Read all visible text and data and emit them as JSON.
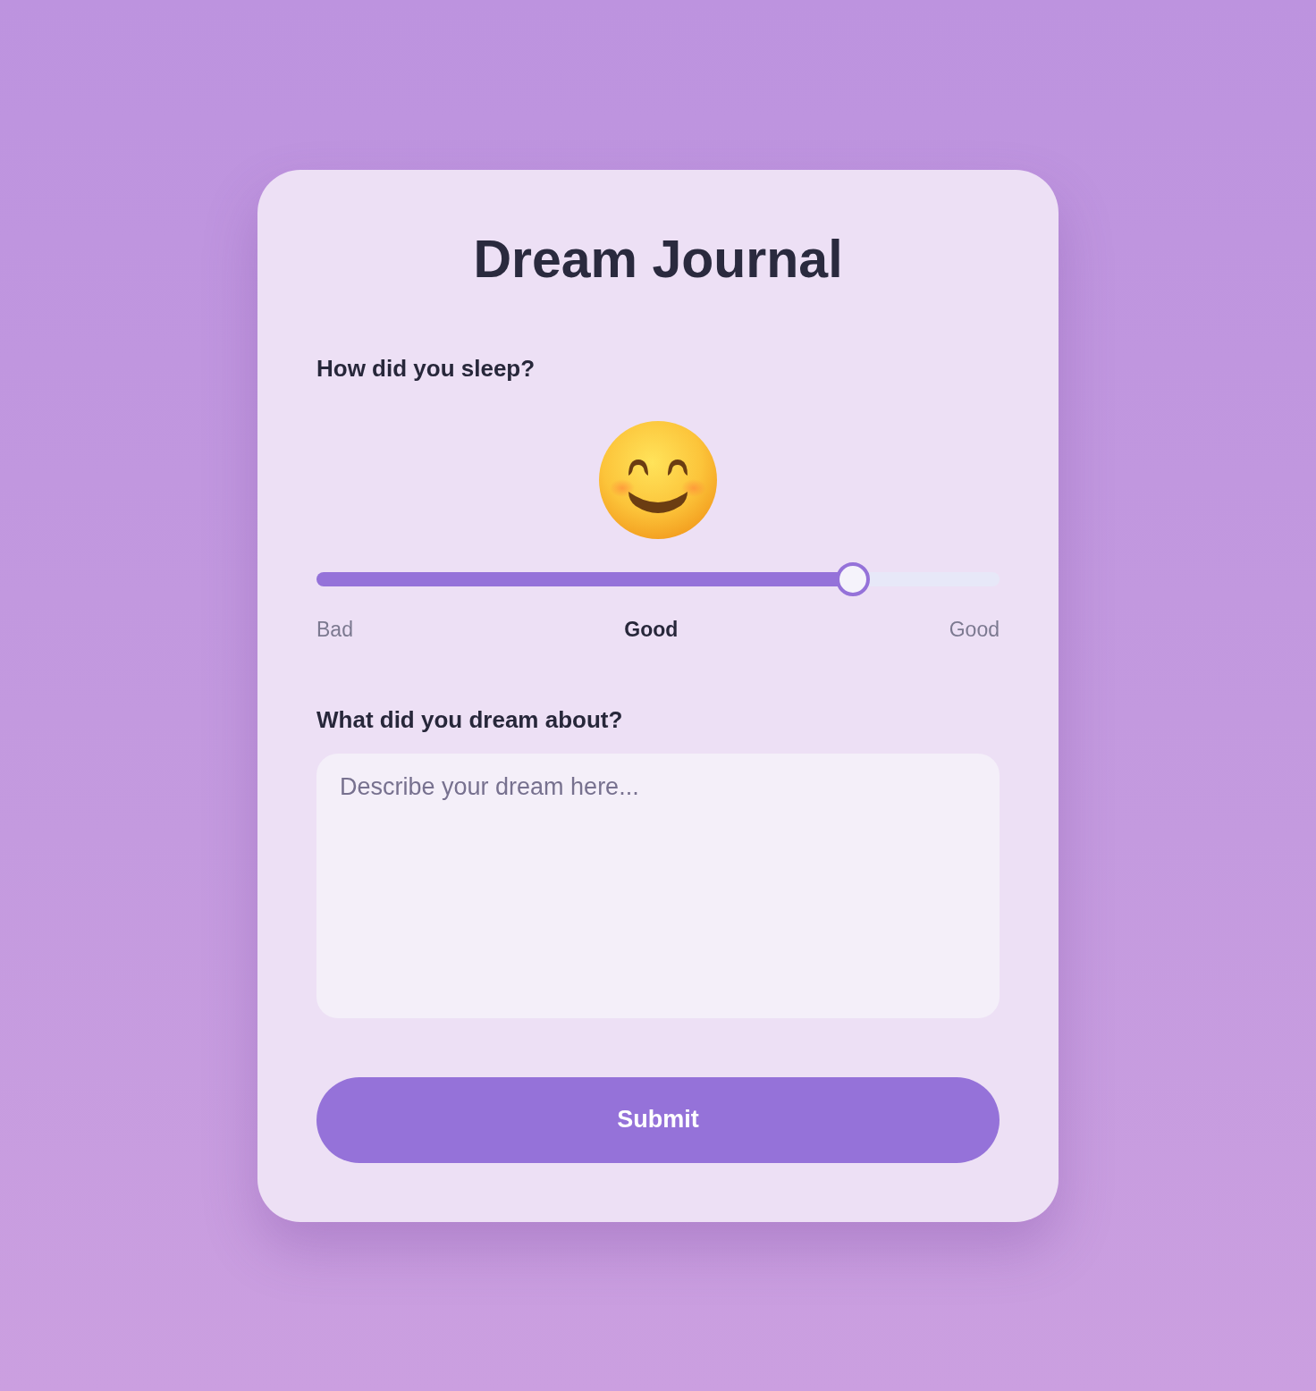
{
  "card": {
    "title": "Dream Journal"
  },
  "sleep": {
    "label": "How did you sleep?",
    "slider": {
      "level": 0.8,
      "min_label": "Bad",
      "value_label": "Good",
      "max_label": "Good"
    }
  },
  "dream": {
    "label": "What did you dream about?",
    "placeholder": "Describe your dream here..."
  },
  "submit": {
    "label": "Submit"
  }
}
